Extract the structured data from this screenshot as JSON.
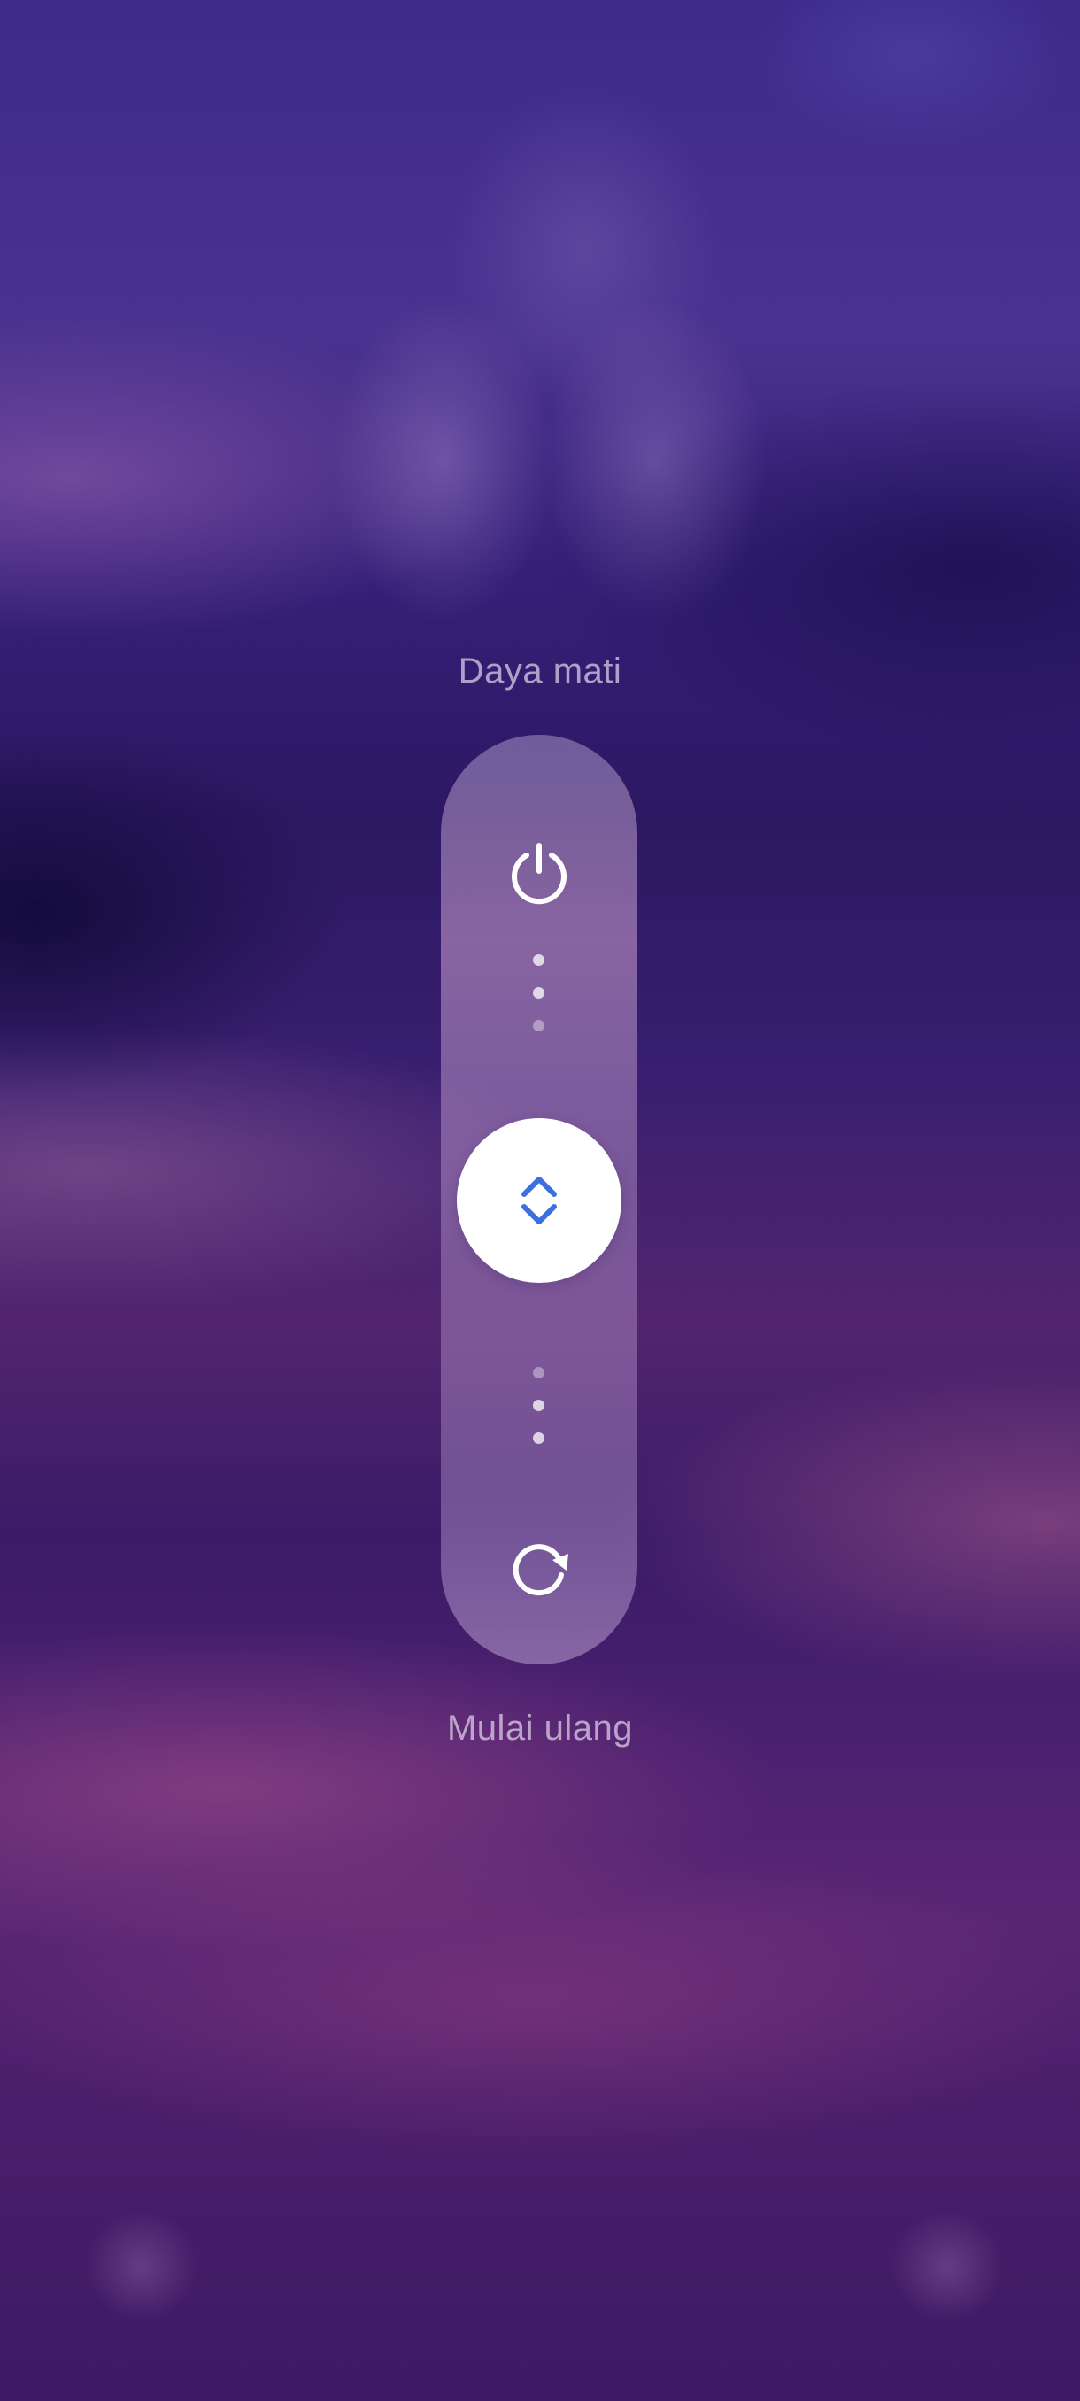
{
  "power_menu": {
    "power_off_label": "Daya mati",
    "restart_label": "Mulai ulang",
    "icons": {
      "top": "power-icon",
      "handle": "chevron-up-down-icon",
      "bottom": "restart-icon"
    },
    "colors": {
      "handle_arrow": "#3d6fe0",
      "slider_track": "rgba(225,200,240,0.4)",
      "label_text": "#d9cbe6"
    }
  }
}
